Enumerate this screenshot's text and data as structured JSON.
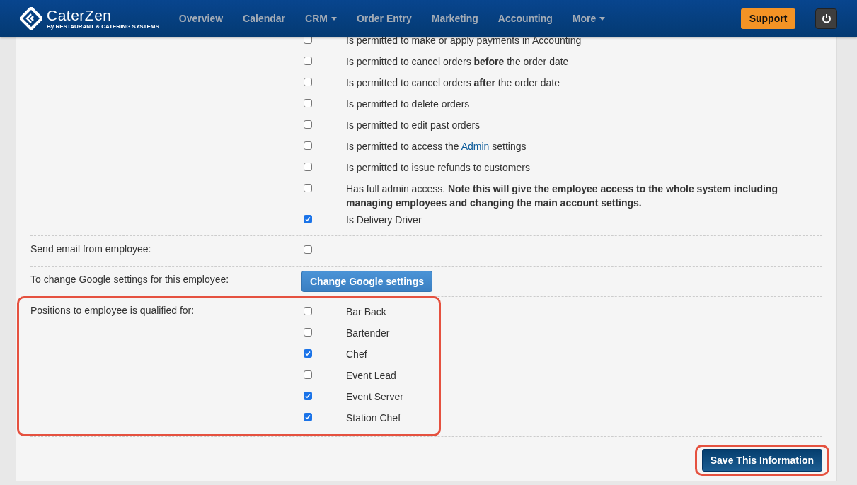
{
  "nav": {
    "logo": "CaterZen",
    "logo_tagline": "By RESTAURANT & CATERING SYSTEMS",
    "items": [
      {
        "label": "Overview",
        "dropdown": false
      },
      {
        "label": "Calendar",
        "dropdown": false
      },
      {
        "label": "CRM",
        "dropdown": true
      },
      {
        "label": "Order Entry",
        "dropdown": false
      },
      {
        "label": "Marketing",
        "dropdown": false
      },
      {
        "label": "Accounting",
        "dropdown": false
      },
      {
        "label": "More",
        "dropdown": true
      }
    ],
    "support": "Support"
  },
  "permissions": [
    {
      "checked": false,
      "parts": [
        {
          "kind": "plain",
          "text": "Is permitted to make or apply payments in Accounting"
        }
      ]
    },
    {
      "checked": false,
      "parts": [
        {
          "kind": "plain",
          "text": "Is permitted to cancel orders "
        },
        {
          "kind": "bold",
          "text": "before"
        },
        {
          "kind": "plain",
          "text": " the order date"
        }
      ]
    },
    {
      "checked": false,
      "parts": [
        {
          "kind": "plain",
          "text": "Is permitted to cancel orders "
        },
        {
          "kind": "bold",
          "text": "after"
        },
        {
          "kind": "plain",
          "text": " the order date"
        }
      ]
    },
    {
      "checked": false,
      "parts": [
        {
          "kind": "plain",
          "text": "Is permitted to delete orders"
        }
      ]
    },
    {
      "checked": false,
      "parts": [
        {
          "kind": "plain",
          "text": "Is permitted to edit past orders"
        }
      ]
    },
    {
      "checked": false,
      "parts": [
        {
          "kind": "plain",
          "text": "Is permitted to access the "
        },
        {
          "kind": "link",
          "text": "Admin"
        },
        {
          "kind": "plain",
          "text": " settings"
        }
      ]
    },
    {
      "checked": false,
      "parts": [
        {
          "kind": "plain",
          "text": "Is permitted to issue refunds to customers"
        }
      ]
    },
    {
      "checked": false,
      "parts": [
        {
          "kind": "plain",
          "text": "Has full admin access. "
        },
        {
          "kind": "bold",
          "text": "Note this will give the employee access to the whole system including managing employees and changing the main account settings."
        }
      ]
    },
    {
      "checked": true,
      "parts": [
        {
          "kind": "plain",
          "text": "Is Delivery Driver"
        }
      ]
    }
  ],
  "send_email": {
    "label": "Send email from employee:",
    "checked": false
  },
  "google": {
    "label": "To change Google settings for this employee:",
    "button": "Change Google settings"
  },
  "positions": {
    "label": "Positions to employee is qualified for:",
    "highlighted": true,
    "items": [
      {
        "label": "Bar Back",
        "checked": false
      },
      {
        "label": "Bartender",
        "checked": false
      },
      {
        "label": "Chef",
        "checked": true
      },
      {
        "label": "Event Lead",
        "checked": false
      },
      {
        "label": "Event Server",
        "checked": true
      },
      {
        "label": "Station Chef",
        "checked": true
      }
    ]
  },
  "save": {
    "label": "Save This Information",
    "highlighted": true
  }
}
